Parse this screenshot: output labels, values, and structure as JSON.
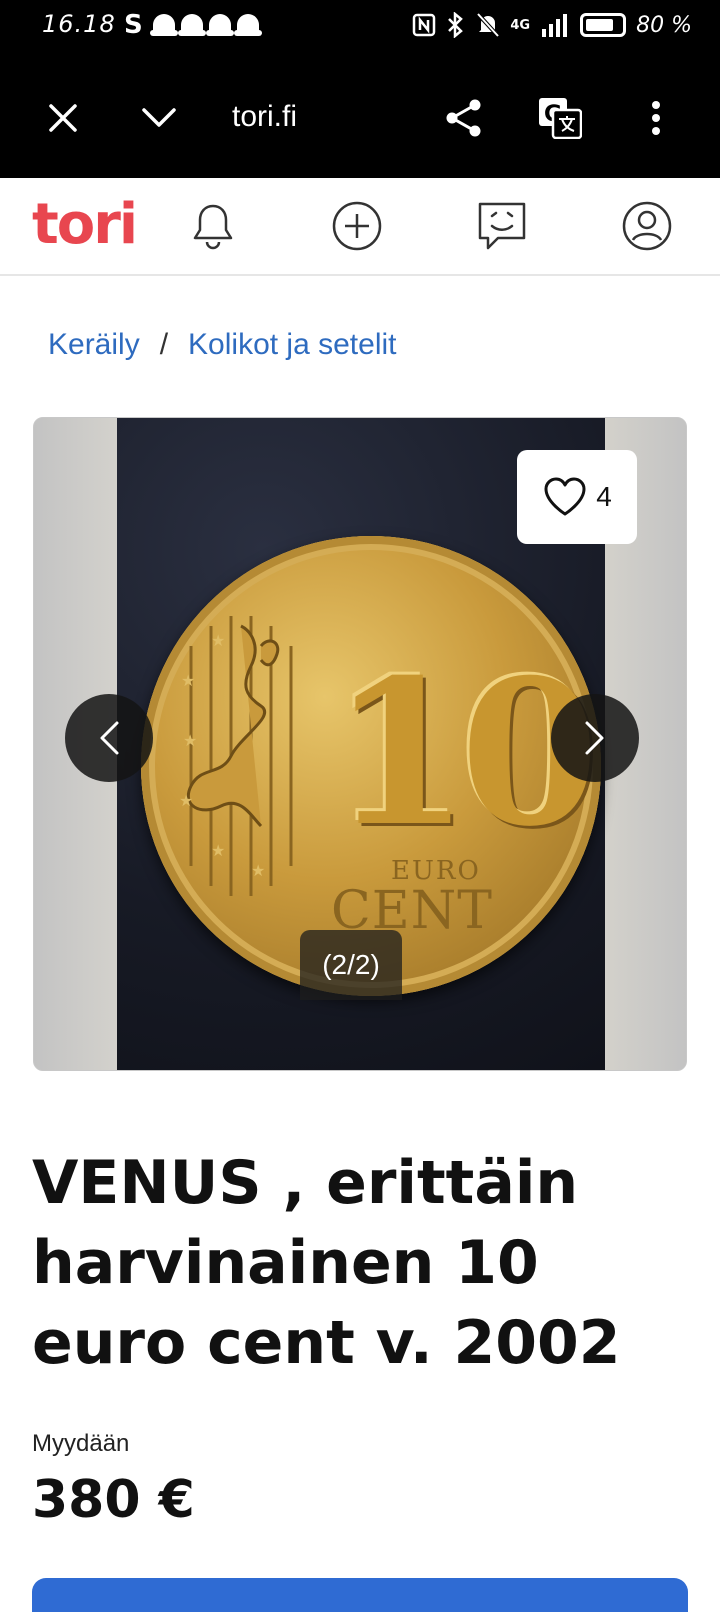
{
  "status_bar": {
    "time": "16.18",
    "notif_letter": "S",
    "network": "4G",
    "battery": "80 %"
  },
  "browser": {
    "url": "tori.fi"
  },
  "site": {
    "logo": "tori",
    "accent": "#e8464f"
  },
  "breadcrumb": {
    "items": [
      "Keräily",
      "Kolikot ja setelit"
    ],
    "separator": "/"
  },
  "gallery": {
    "favorite_count": "4",
    "counter": "(2/2)",
    "coin_value": "10",
    "coin_euro": "EURO",
    "coin_cent": "CENT"
  },
  "listing": {
    "title": "VENUS , erittäin harvinainen 10 euro cent v. 2002",
    "type": "Myydään",
    "price": "380 €"
  },
  "colors": {
    "link": "#2e6bbf",
    "primary_button": "#2f6bd3"
  }
}
